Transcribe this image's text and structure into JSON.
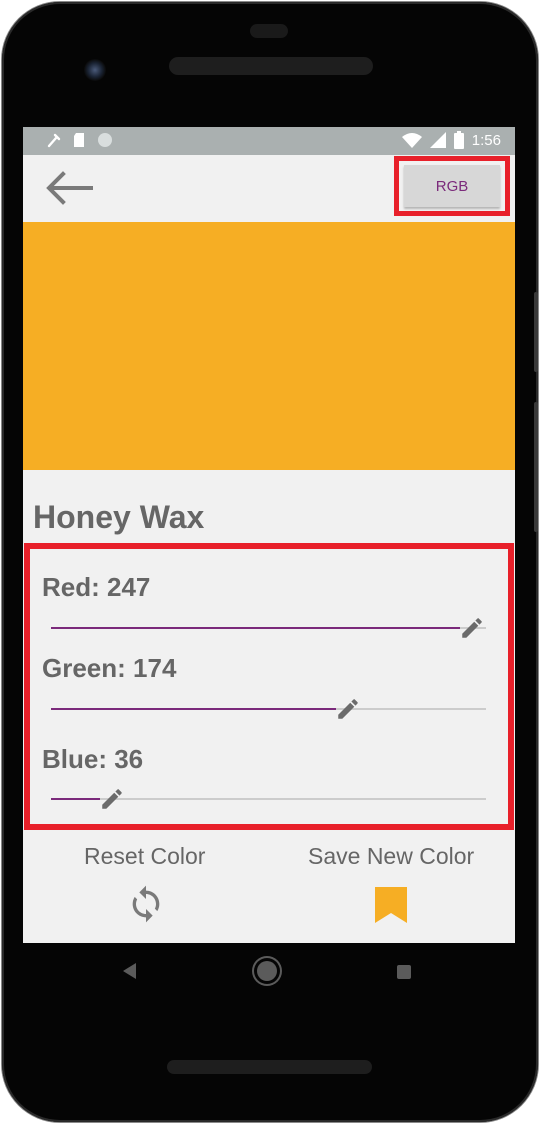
{
  "status_bar": {
    "time": "1:56"
  },
  "app_bar": {
    "back_icon": "arrow-left-icon",
    "mode_button_label": "RGB"
  },
  "swatch": {
    "color": "#f6ae24"
  },
  "color_name": "Honey Wax",
  "sliders": [
    {
      "label": "Red: 247",
      "channel": "red",
      "value": 247,
      "max": 255
    },
    {
      "label": "Green: 174",
      "channel": "green",
      "value": 174,
      "max": 255
    },
    {
      "label": "Blue: 36",
      "channel": "blue",
      "value": 36,
      "max": 255
    }
  ],
  "actions": {
    "reset_label": "Reset Color",
    "reset_icon": "refresh-icon",
    "save_label": "Save New Color",
    "save_icon": "bookmark-icon"
  },
  "colors": {
    "accent": "#7b2a7b",
    "highlight_border": "#e8202a",
    "bookmark": "#f6ae24",
    "text": "#666666"
  }
}
